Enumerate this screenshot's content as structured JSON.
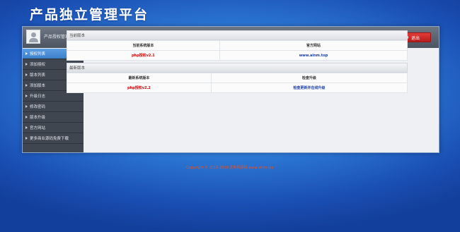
{
  "header": {
    "brand_title": "产品独立管理平台"
  },
  "topbar": {
    "center_title": "产品授权管理中心",
    "logout_label": "退出"
  },
  "sidebar": {
    "items": [
      {
        "label": "授权列表",
        "active": true
      },
      {
        "label": "添加授权"
      },
      {
        "label": "版本列表"
      },
      {
        "label": "添加版本"
      },
      {
        "label": "升级日志"
      },
      {
        "label": "修改密码"
      },
      {
        "label": "版本升级"
      },
      {
        "label": "官方网站"
      },
      {
        "label": "更多商业源码免费下载"
      }
    ]
  },
  "main": {
    "current": {
      "heading": "当前版本",
      "col_version": "当前系统版本",
      "col_site": "官方网站",
      "version": "php授权v2.1",
      "site": "www.ainm.top"
    },
    "latest": {
      "heading": "最新版本",
      "col_version": "最新系统版本",
      "col_update": "检查升级",
      "version": "php授权v2.2",
      "update_link": "检查更新并在线升级"
    }
  },
  "footer": {
    "copyright": "Copyright © 2016-2018 爱陶网源码 www.ainm.top"
  },
  "colors": {
    "accent_blue": "#3b7fcb",
    "logout_red": "#d32f2f",
    "version_red": "#d10000",
    "link_blue": "#1a3fa8"
  }
}
